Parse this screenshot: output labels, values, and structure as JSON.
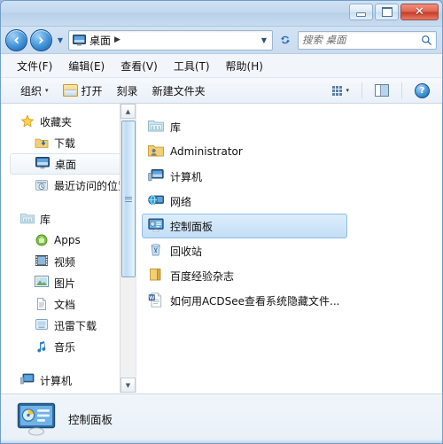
{
  "window": {
    "buttons": {
      "minimize": "minimize-button",
      "maximize": "maximize-button",
      "close": "close-button",
      "close_glyph": "✕"
    }
  },
  "address": {
    "back_icon": "back-arrow-icon",
    "forward_icon": "forward-arrow-icon",
    "history_caret": "▼",
    "location_icon": "desktop-icon",
    "location": "桌面",
    "separator": "▶",
    "dropdown_caret": "▼",
    "refresh_icon": "↻"
  },
  "search": {
    "placeholder": "搜索 桌面",
    "value": "",
    "icon": "🔍"
  },
  "menu": {
    "items": [
      {
        "label": "文件(F)",
        "name": "menu-file"
      },
      {
        "label": "编辑(E)",
        "name": "menu-edit"
      },
      {
        "label": "查看(V)",
        "name": "menu-view"
      },
      {
        "label": "工具(T)",
        "name": "menu-tools"
      },
      {
        "label": "帮助(H)",
        "name": "menu-help"
      }
    ]
  },
  "toolbar": {
    "organize_label": "组织",
    "organize_caret": "▾",
    "open_label": "打开",
    "burn_label": "刻录",
    "new_folder_label": "新建文件夹",
    "view_caret": "▾",
    "help_glyph": "?"
  },
  "sidebar": {
    "favorites": {
      "label": "收藏夹",
      "items": [
        {
          "label": "下载",
          "icon": "download-folder-icon",
          "selected": false
        },
        {
          "label": "桌面",
          "icon": "desktop-icon",
          "selected": true
        },
        {
          "label": "最近访问的位置",
          "icon": "recent-places-icon",
          "selected": false
        }
      ]
    },
    "libraries": {
      "label": "库",
      "items": [
        {
          "label": "Apps",
          "icon": "apps-library-icon"
        },
        {
          "label": "视频",
          "icon": "videos-library-icon"
        },
        {
          "label": "图片",
          "icon": "pictures-library-icon"
        },
        {
          "label": "文档",
          "icon": "documents-library-icon"
        },
        {
          "label": "迅雷下载",
          "icon": "thunder-download-icon"
        },
        {
          "label": "音乐",
          "icon": "music-library-icon"
        }
      ]
    },
    "computer": {
      "label": "计算机",
      "icon": "computer-icon"
    },
    "scrollbar": {
      "up_glyph": "▲",
      "down_glyph": "▼"
    }
  },
  "files": {
    "rows": [
      {
        "label": "库",
        "icon": "library-folder-icon",
        "selected": false
      },
      {
        "label": "Administrator",
        "icon": "user-folder-icon",
        "selected": false
      },
      {
        "label": "计算机",
        "icon": "computer-icon",
        "selected": false
      },
      {
        "label": "网络",
        "icon": "network-icon",
        "selected": false
      },
      {
        "label": "控制面板",
        "icon": "control-panel-icon",
        "selected": true
      },
      {
        "label": "回收站",
        "icon": "recycle-bin-icon",
        "selected": false
      },
      {
        "label": "百度经验杂志",
        "icon": "folder-icon",
        "selected": false
      },
      {
        "label": "如何用ACDSee查看系统隐藏文件...",
        "icon": "word-document-icon",
        "selected": false
      }
    ]
  },
  "statusbar": {
    "icon": "control-panel-icon",
    "label": "控制面板"
  },
  "colors": {
    "accent": "#3c8ed3",
    "selection_fill": "#cfe6f9",
    "selection_border": "#8ebde4",
    "close_button": "#c63a25",
    "title_bar": "#c3d8ee"
  }
}
